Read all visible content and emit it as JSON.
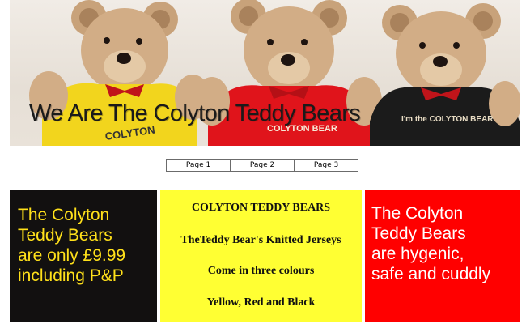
{
  "header": {
    "title": "We Are The Colyton Teddy Bears",
    "shirts": [
      {
        "color": "#f2d51d",
        "text": "COLYTON"
      },
      {
        "color": "#e0141b",
        "text": "COLYTON BEAR"
      },
      {
        "color": "#1b1b1b",
        "text": "I'm the COLYTON BEAR"
      }
    ]
  },
  "nav": {
    "items": [
      "Page 1",
      "Page 2",
      "Page 3"
    ]
  },
  "panels": {
    "left": {
      "lines": [
        "The Colyton",
        "Teddy Bears",
        "are only £9.99",
        "including P&P"
      ],
      "bg": "#121010",
      "text_color": "#ffe01a"
    },
    "middle": {
      "lines": [
        "COLYTON TEDDY BEARS",
        "TheTeddy Bear's Knitted Jerseys",
        "Come in three colours",
        "Yellow, Red and Black"
      ],
      "bg": "#ffff33"
    },
    "right": {
      "lines": [
        "The Colyton",
        "Teddy Bears",
        "are hygenic,",
        "safe and cuddly"
      ],
      "bg": "#ff0000",
      "text_color": "#ffffff"
    }
  }
}
